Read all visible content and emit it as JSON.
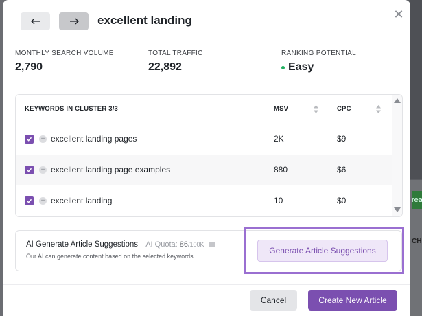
{
  "header": {
    "title": "excellent landing",
    "close_icon": "close-icon",
    "back_icon": "arrow-left-icon",
    "forward_icon": "arrow-right-icon"
  },
  "stats": [
    {
      "label": "MONTHLY SEARCH VOLUME",
      "value": "2,790"
    },
    {
      "label": "TOTAL TRAFFIC",
      "value": "22,892"
    },
    {
      "label": "RANKING POTENTIAL",
      "value": "Easy",
      "indicator_color": "#22b061"
    }
  ],
  "table": {
    "columns": [
      "KEYWORDS IN CLUSTER 3/3",
      "MSV",
      "CPC"
    ],
    "rows": [
      {
        "keyword": "excellent landing pages",
        "msv": "2K",
        "cpc": "$9",
        "checked": true
      },
      {
        "keyword": "excellent landing page examples",
        "msv": "880",
        "cpc": "$6",
        "checked": true
      },
      {
        "keyword": "excellent landing",
        "msv": "10",
        "cpc": "$0",
        "checked": true
      }
    ]
  },
  "ai": {
    "title": "AI Generate Article Suggestions",
    "quota_label": "AI Quota:",
    "quota_used": "86",
    "quota_total": "/100K",
    "description": "Our AI can generate content based on the selected keywords.",
    "generate_label": "Generate Article Suggestions"
  },
  "footer": {
    "cancel_label": "Cancel",
    "create_label": "Create New Article"
  },
  "background": {
    "right_green_text": "rea",
    "right_text": "CH"
  },
  "colors": {
    "accent": "#7b4fb0",
    "highlight": "#9a6fd1",
    "easy": "#22b061"
  }
}
